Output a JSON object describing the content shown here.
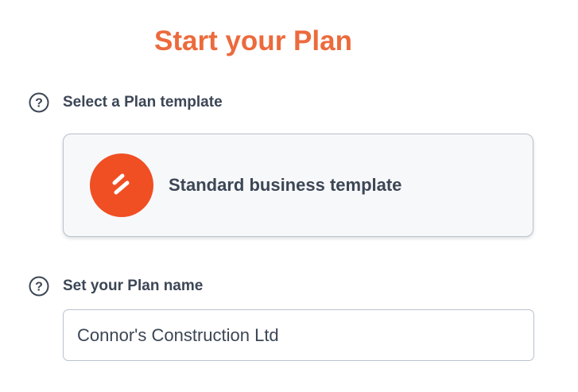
{
  "header": {
    "title": "Start your Plan"
  },
  "template_section": {
    "label": "Select a Plan template",
    "help_icon": "question-circle-icon",
    "selected_template": {
      "name": "Standard business template",
      "logo_icon": "brand-slash-logo"
    }
  },
  "name_section": {
    "label": "Set your Plan name",
    "help_icon": "question-circle-icon",
    "input_value": "Connor's Construction Ltd"
  },
  "colors": {
    "accent": "#ec6a3c",
    "logo_bg": "#f04e23",
    "text": "#3c4655",
    "border": "#b9c2ce",
    "card_bg": "#f7f8fa"
  }
}
